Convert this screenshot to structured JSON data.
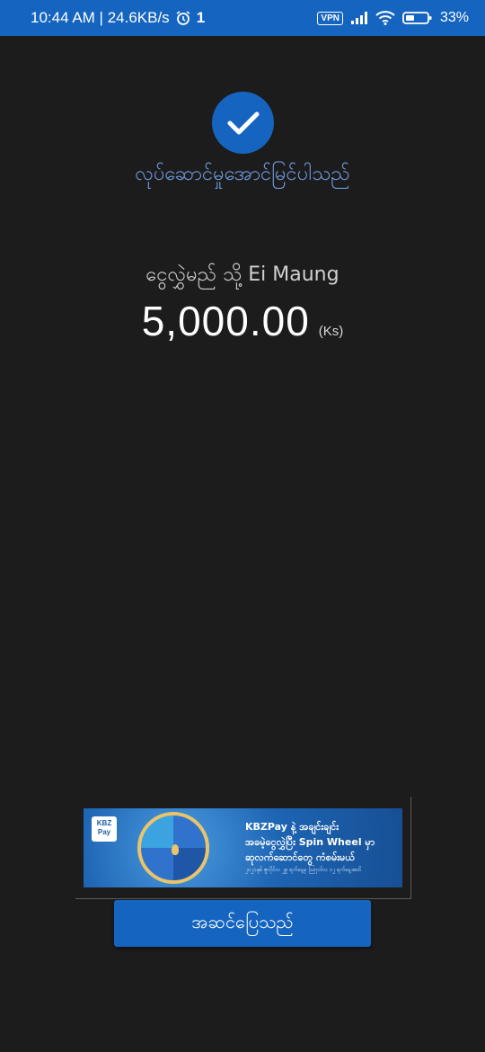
{
  "status_bar": {
    "time_speed": "10:44 AM | 24.6KB/s",
    "sim_indicator": "1",
    "vpn": "VPN",
    "battery": "33%",
    "icons": [
      "alarm-icon",
      "signal-icon",
      "wifi-icon",
      "battery-icon"
    ]
  },
  "success": {
    "icon": "check-icon",
    "message": "လုပ်ဆောင်မှုအောင်မြင်ပါသည်"
  },
  "transfer": {
    "recipient_line": "ငွေလွှဲမည် သို့ Ei Maung",
    "amount": "5,000.00",
    "currency": "(Ks)"
  },
  "banner": {
    "logo_text": "KBZ Pay",
    "line1": "KBZPay နဲ့ အချင်းချင်း",
    "line2": "အခမဲ့ငွေလွှဲပြီး Spin Wheel မှာ",
    "line3": "ဆုလက်ဆောင်တွေ ကံစမ်းမယ်",
    "line4": "၂၀၂၁နှစ် ဇူလိုင်လ ၂၉ ရက်နေ့မှ ဩဂုတ်လ ၁၂ ရက်နေ့အထိ"
  },
  "actions": {
    "done_label": "အဆင်ပြေသည်"
  },
  "colors": {
    "accent": "#1565c0",
    "success_text": "#6f9be0",
    "background": "#1c1c1c"
  }
}
